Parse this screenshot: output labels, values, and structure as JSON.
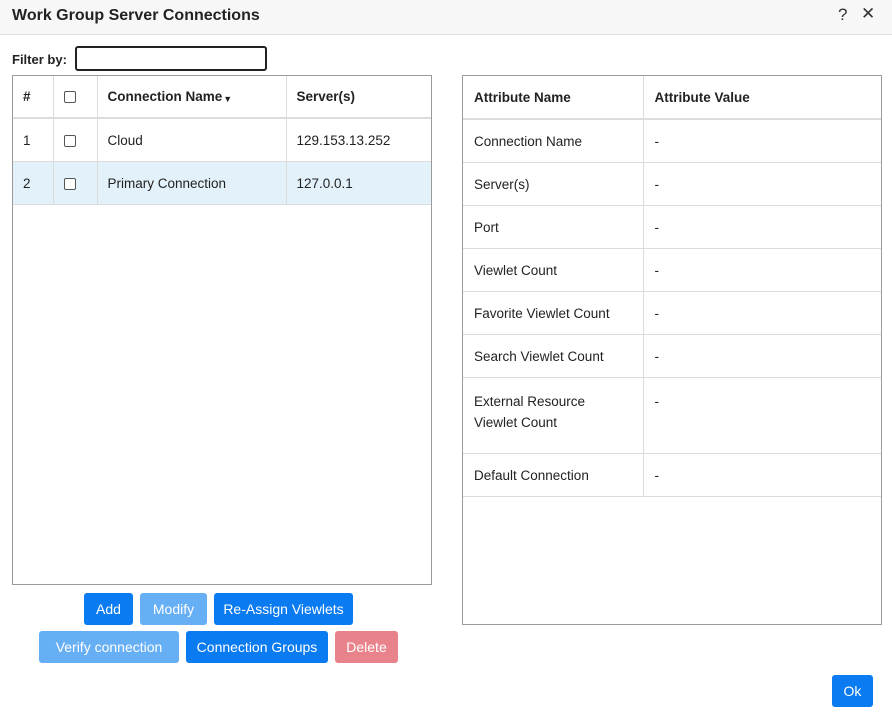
{
  "dialog": {
    "title": "Work Group Server Connections",
    "help_glyph": "?",
    "close_glyph": "✕"
  },
  "filter": {
    "label": "Filter by:",
    "value": ""
  },
  "connections": {
    "headers": {
      "num": "#",
      "name": "Connection Name",
      "servers": "Server(s)"
    },
    "rows": [
      {
        "num": "1",
        "name": "Cloud",
        "server": "129.153.13.252"
      },
      {
        "num": "2",
        "name": "Primary Connection",
        "server": "127.0.0.1"
      }
    ]
  },
  "attributes": {
    "headers": {
      "name": "Attribute Name",
      "value": "Attribute Value"
    },
    "rows": [
      {
        "name": "Connection Name",
        "value": "-"
      },
      {
        "name": "Server(s)",
        "value": "-"
      },
      {
        "name": "Port",
        "value": "-"
      },
      {
        "name": "Viewlet Count",
        "value": "-"
      },
      {
        "name": "Favorite Viewlet Count",
        "value": "-"
      },
      {
        "name": "Search Viewlet Count",
        "value": "-"
      },
      {
        "name": "External Resource Viewlet Count",
        "value": "-"
      },
      {
        "name": "Default Connection",
        "value": "-"
      }
    ]
  },
  "buttons": {
    "add": "Add",
    "modify": "Modify",
    "reassign": "Re-Assign Viewlets",
    "verify": "Verify connection",
    "groups": "Connection Groups",
    "delete": "Delete",
    "ok": "Ok"
  },
  "colors": {
    "primary": "#0a7bf0",
    "primary_disabled": "#66aff5",
    "danger_disabled": "#e9838b",
    "selected_row": "#e3f2fa"
  }
}
